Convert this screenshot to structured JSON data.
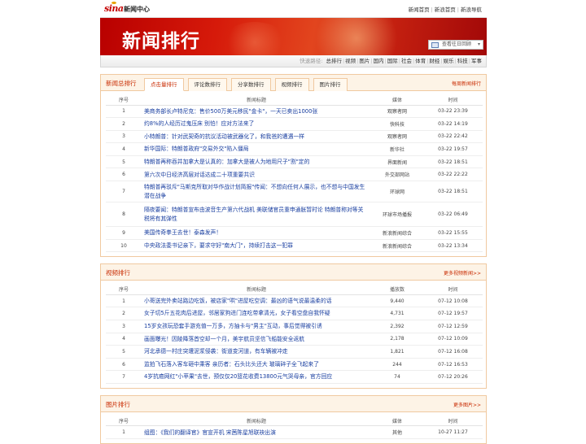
{
  "header": {
    "logo_text": "sina",
    "logo_sub": "新闻中心",
    "links": [
      "新闻首页",
      "新浪首页",
      "新浪导航"
    ]
  },
  "banner": {
    "title": "新闻排行",
    "history_label": "查看往日回顾"
  },
  "nav": {
    "label": "快速路径:",
    "items": [
      "总排行",
      "视频",
      "图片",
      "国内",
      "国际",
      "社会",
      "体育",
      "财经",
      "娱乐",
      "科技",
      "军事"
    ]
  },
  "news": {
    "title": "新闻总排行",
    "more": "每周新闻排行",
    "tabs": [
      "点击量排行",
      "评论数排行",
      "分享数排行",
      "视频排行",
      "图片排行"
    ],
    "columns": [
      "序号",
      "新闻标题",
      "媒体",
      "时间"
    ],
    "rows": [
      {
        "no": "1",
        "title": "美商务部长卢特尼克：售价500万美元移民\"金卡\"，一天已卖出1000张",
        "media": "观察者网",
        "time": "03-22 23:39"
      },
      {
        "no": "2",
        "title": "约8%的人经历过鬼压床 别怕！应对方法来了",
        "media": "快科技",
        "time": "03-22 14:19"
      },
      {
        "no": "3",
        "title": "小特朗普：针对武契奇的抗议活动被武器化了，和我爸的遭遇一样",
        "media": "观察者网",
        "time": "03-22 22:42"
      },
      {
        "no": "4",
        "title": "新华国际：特朗普政府\"交易外交\"陷入僵局",
        "media": "新华社",
        "time": "03-22 19:57"
      },
      {
        "no": "5",
        "title": "特朗普再称吞并加拿大是认真的：加拿大是被人为地用尺子\"割\"定的",
        "media": "界面新闻",
        "time": "03-22 18:51"
      },
      {
        "no": "6",
        "title": "第六次中日经济高层对话达成二十项重要共识",
        "media": "外交部网站",
        "time": "03-22 22:22"
      },
      {
        "no": "7",
        "title": "特朗普再驳斥\"马斯克所取对华作战计划简报\"传闻：不想向任何人展示，也不想与中国发生潜在战争",
        "media": "环球网",
        "time": "03-22 18:51"
      },
      {
        "no": "8",
        "title": "隔夜要闻：特朗普宣布由波音生产第六代战机 美联储官员重申通胀暂时论 特朗普称对等关税将有其弹性",
        "media": "环球市场播报",
        "time": "03-22 06:49"
      },
      {
        "no": "9",
        "title": "美国传奇拳王去世！泰森发声！",
        "media": "新浪新闻综合",
        "time": "03-22 15:55"
      },
      {
        "no": "10",
        "title": "中央政法委书记亲下，要求守好\"南大门\"，持续打击这一犯罪",
        "media": "新浪新闻综合",
        "time": "03-22 13:34"
      }
    ]
  },
  "video": {
    "title": "视频排行",
    "more": "更多视频新闻>>",
    "columns": [
      "序号",
      "新闻标题",
      "播放数",
      "时间"
    ],
    "rows": [
      {
        "no": "1",
        "title": "小哥送完外卖站路边吃饭，被店家\"哄\"进屋吃空调：最凶的语气说最温柔的话",
        "count": "9,440",
        "time": "07-12 10:08"
      },
      {
        "no": "2",
        "title": "女子切5斤五花肉后进屋，邻居家狗进门连吃带拿清光，女子看空盘自我怀疑",
        "count": "4,731",
        "time": "07-12 19:57"
      },
      {
        "no": "3",
        "title": "15岁女孩玩恐套手游充值一万多，方抽卡与\"男主\"互动，事后觉得被引诱",
        "count": "2,392",
        "time": "07-12 12:59"
      },
      {
        "no": "4",
        "title": "画面曝光！因陵降落首空却一个月，美宇航员坚信飞船能安全返航",
        "count": "2,178",
        "time": "07-12 10:09"
      },
      {
        "no": "5",
        "title": "河北承德一村庄突遭泥浆侵袭：街道变河道，有车辆被冲走",
        "count": "1,821",
        "time": "07-12 16:08"
      },
      {
        "no": "6",
        "title": "监拍飞石落入客车砸中乘客 亲历者：石头比头还大 玻璃碎子全飞起来了",
        "count": "244",
        "time": "07-12 16:53"
      },
      {
        "no": "7",
        "title": "4岁抗癌网红\"小苹果\"去世，预仅仅20篮花收费13800元气哭母亲，官方回应",
        "count": "74",
        "time": "07-12 20:26"
      }
    ]
  },
  "photo": {
    "title": "图片排行",
    "more": "更多图片>>",
    "columns": [
      "序号",
      "新闻标题",
      "媒体",
      "时间"
    ],
    "rows": [
      {
        "no": "1",
        "title": "组图：《我们的翻译官》官宣开机 宋茜陈星旭联袂出演",
        "media": "其他",
        "time": "10-27 11:27"
      }
    ]
  },
  "colors": {
    "accent": "#c82a00",
    "link": "#1a3fa0",
    "banner": "#d61a0a",
    "section_border": "#f0c9a0"
  }
}
